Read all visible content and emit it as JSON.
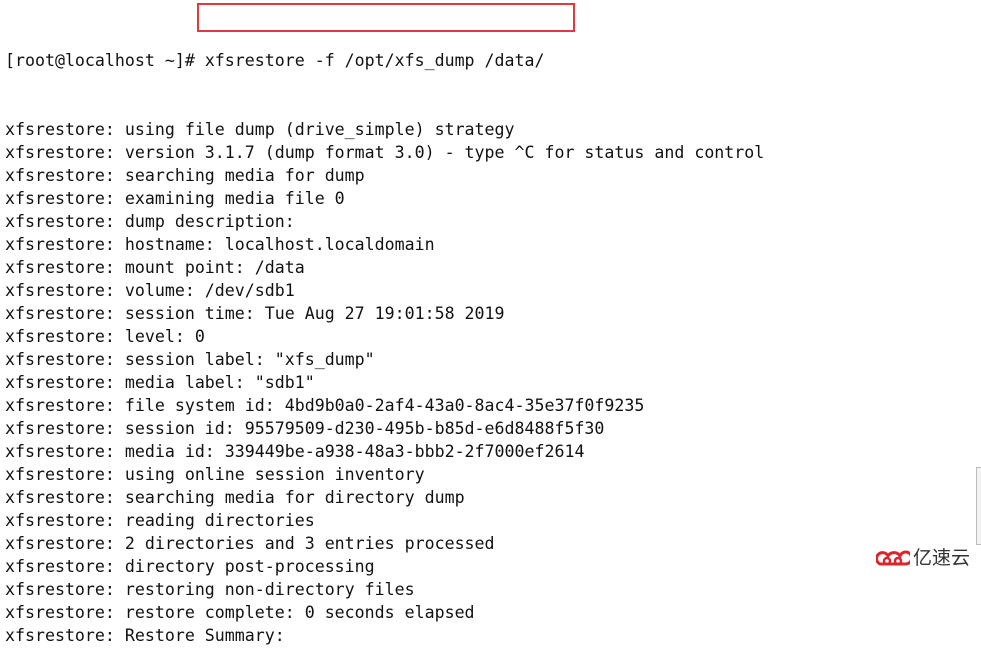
{
  "terminal": {
    "prompt": "[root@localhost ~]# ",
    "command": "xfsrestore -f /opt/xfs_dump /data/",
    "output": [
      "xfsrestore: using file dump (drive_simple) strategy",
      "xfsrestore: version 3.1.7 (dump format 3.0) - type ^C for status and control",
      "xfsrestore: searching media for dump",
      "xfsrestore: examining media file 0",
      "xfsrestore: dump description:",
      "xfsrestore: hostname: localhost.localdomain",
      "xfsrestore: mount point: /data",
      "xfsrestore: volume: /dev/sdb1",
      "xfsrestore: session time: Tue Aug 27 19:01:58 2019",
      "xfsrestore: level: 0",
      "xfsrestore: session label: \"xfs_dump\"",
      "xfsrestore: media label: \"sdb1\"",
      "xfsrestore: file system id: 4bd9b0a0-2af4-43a0-8ac4-35e37f0f9235",
      "xfsrestore: session id: 95579509-d230-495b-b85d-e6d8488f5f30",
      "xfsrestore: media id: 339449be-a938-48a3-bbb2-2f7000ef2614",
      "xfsrestore: using online session inventory",
      "xfsrestore: searching media for directory dump",
      "xfsrestore: reading directories",
      "xfsrestore: 2 directories and 3 entries processed",
      "xfsrestore: directory post-processing",
      "xfsrestore: restoring non-directory files",
      "xfsrestore: restore complete: 0 seconds elapsed",
      "xfsrestore: Restore Summary:"
    ]
  },
  "highlight_color": "#e0393e",
  "watermark": {
    "text": "亿速云",
    "icon": "cloud-logo-icon",
    "color": "#d9262c"
  }
}
